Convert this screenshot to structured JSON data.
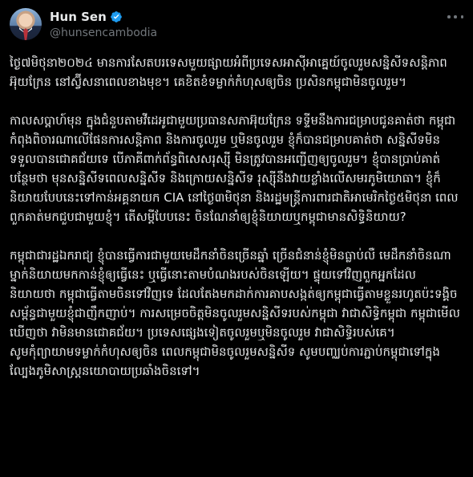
{
  "author": {
    "display_name": "Hun Sen",
    "handle": "@hunsencambodia",
    "verified_icon": "verified-badge-icon",
    "accent": "#1d9bf0"
  },
  "tweet": {
    "paragraphs": [
      "ថ្ងៃ៧មិថុនា២០២៤ មានការសែតបរទេសមួយផ្សាយអំពីប្រទេសអាស៊ីអាគ្នេយ៍ចូលរួមសន្និសីទសន្តិភាពអ៊ុយក្រែន នៅស្វ៊ីសនាពេលខាងមុខ។ គេខិតខំទម្លាក់កំហុសឲ្យចិន ប្រសិនកម្ពុជាមិនចូលរួម។",
      "កាលសប្តាហ៍មុន ក្នុងជំនួបតាមវីដេអូជាមួយប្រធានសភាអ៊ុយក្រែន ទទ្ទីមនឹងការជម្រាបជូនគាត់ថា កម្ពុជាកំពុងពិចារណាលើផែនការសន្តិភាព និងការចូលរួម ឬមិនចូលរួម ខ្ញុំក៏បានជម្រាបគាត់ថា សន្និសីទមិនទទួលបានជោគជ័យទេ បើភាគីពាក់ព័ន្ធពិសេសរុស្ស៊ី មិនត្រូវបានអញ្ជើញឲ្យចូលរួម។ ខ្ញុំបានប្រាប់គាត់បន្ថែមថា មុនសន្និសីទពេលសន្និសីទ និងក្រោយសន្និសីទ រុស្ស៊ីនឹងវាយខ្លាំងលើសមរភូមិយោធា។ ខ្ញុំក៏និយាយបែបនេះទៅកាន់អគ្គនាយក CIA នៅថ្ងៃ៣មិថុនា និងរដ្ឋមន្ត្រីការពារជាតិអាមេរិកថ្ងៃ៥មិថុនា ពេលពួកគាត់មកជួបជាមួយខ្ញុំ។ តើសម្តីបែបនេះ ចិនណែនាំឲ្យខ្ញុំនិយាយឬកម្ពុជាមានសិទ្ធិនិយាយ?",
      "កម្ពុជាជារដ្ឋឯករាជ្យ ខ្ញុំបានធ្វើការជាមួយមេដឹកនាំចិនច្រើនឆ្នាំ ច្រើនជំនាន់ខ្ញុំមិនធ្លាប់លឺ មេដឹកនាំចិនណាម្នាក់និយាយមកកាន់ខ្ញុំឲ្យធ្វើនេះ ឬធ្វើនោះតាមបំណងរបស់ចិនឡើយ។ ផ្ទុយទៅវិញពួកអ្នកដែលនិយាយថា កម្ពុជាធ្វើតាមចិនទៅវិញទេ ដែលតែងមកដាក់ការគាបសង្កត់ឲ្យកម្ពុជាធ្វើតាមខ្លួនរហូតប៉ះទង្គិចសម្ព័ន្ធជាមួយខ្ញុំជាញឹកញាប់។ ការសម្រេចចិត្តមិនចូលរួមសន្និសីទរបស់កម្ពុជា វាជាសិទ្ធិកម្ពុជា កម្ពុជាមើលឃើញថា វាមិនមានជោគជ័យ។ ប្រទេសផ្សេងទៀតចូលរួមឬមិនចូលរួម វាជាសិទ្ធិរបស់គេ។",
      "សូមកុំព្យាយាមទម្លាក់កំហុសឲ្យចិន ពេលកម្ពុជាមិនចូលរួមសន្និសីទ សូមបញ្ឈប់ការភ្ជាប់កម្ពុជាទៅក្នុងល្បែងភូមិសាស្ត្រនយោបាយប្រឆាំងចិនទៅ។"
    ]
  }
}
